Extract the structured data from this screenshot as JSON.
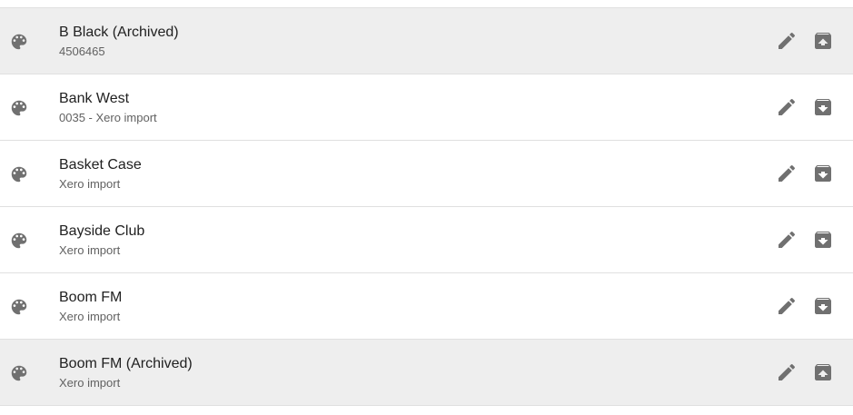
{
  "colors": {
    "archived_row_bg": "#eeeeee",
    "row_bg": "#ffffff",
    "icon": "#707070",
    "title": "#212121",
    "subtitle": "#616161"
  },
  "icons": {
    "avatar": "palette-icon",
    "edit": "pencil-icon",
    "archive": "archive-icon",
    "unarchive": "unarchive-icon"
  },
  "rows": [
    {
      "title": "B Black (Archived)",
      "subtitle": "4506465",
      "archived": true
    },
    {
      "title": "Bank West",
      "subtitle": "0035 - Xero import",
      "archived": false
    },
    {
      "title": "Basket Case",
      "subtitle": "Xero import",
      "archived": false
    },
    {
      "title": "Bayside Club",
      "subtitle": "Xero import",
      "archived": false
    },
    {
      "title": "Boom FM",
      "subtitle": "Xero import",
      "archived": false
    },
    {
      "title": "Boom FM (Archived)",
      "subtitle": "Xero import",
      "archived": true
    }
  ]
}
